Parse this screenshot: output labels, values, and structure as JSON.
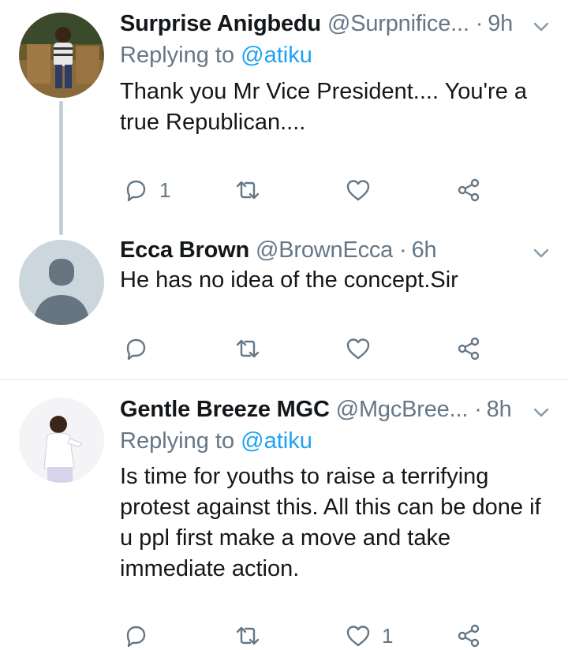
{
  "tweets": [
    {
      "name": "Surprise Anigbedu",
      "handle": "@Surpnifice...",
      "time": "9h",
      "replying_prefix": "Replying to",
      "replying_to": "@atiku",
      "text": "Thank you Mr Vice President.... You're  a true Republican....",
      "reply_count": "1",
      "like_count": ""
    },
    {
      "name": "Ecca Brown",
      "handle": "@BrownEcca",
      "time": "6h",
      "text": "He has no idea of the concept.Sir",
      "reply_count": "",
      "like_count": ""
    },
    {
      "name": "Gentle Breeze MGC",
      "handle": "@MgcBree...",
      "time": "8h",
      "replying_prefix": "Replying to",
      "replying_to": "@atiku",
      "text": "Is time for youths to raise a terrifying protest against this. All this can be done if u ppl first make a move and take immediate action.",
      "reply_count": "",
      "like_count": "1"
    }
  ],
  "icons": {
    "reply": "reply-icon",
    "retweet": "retweet-icon",
    "like": "heart-icon",
    "share": "share-icon",
    "more": "chevron-down-icon"
  },
  "colors": {
    "text": "#14171a",
    "secondary": "#657786",
    "link": "#1da1f2",
    "thread_line": "#c4cfd6",
    "divider": "#e1e8ed"
  }
}
